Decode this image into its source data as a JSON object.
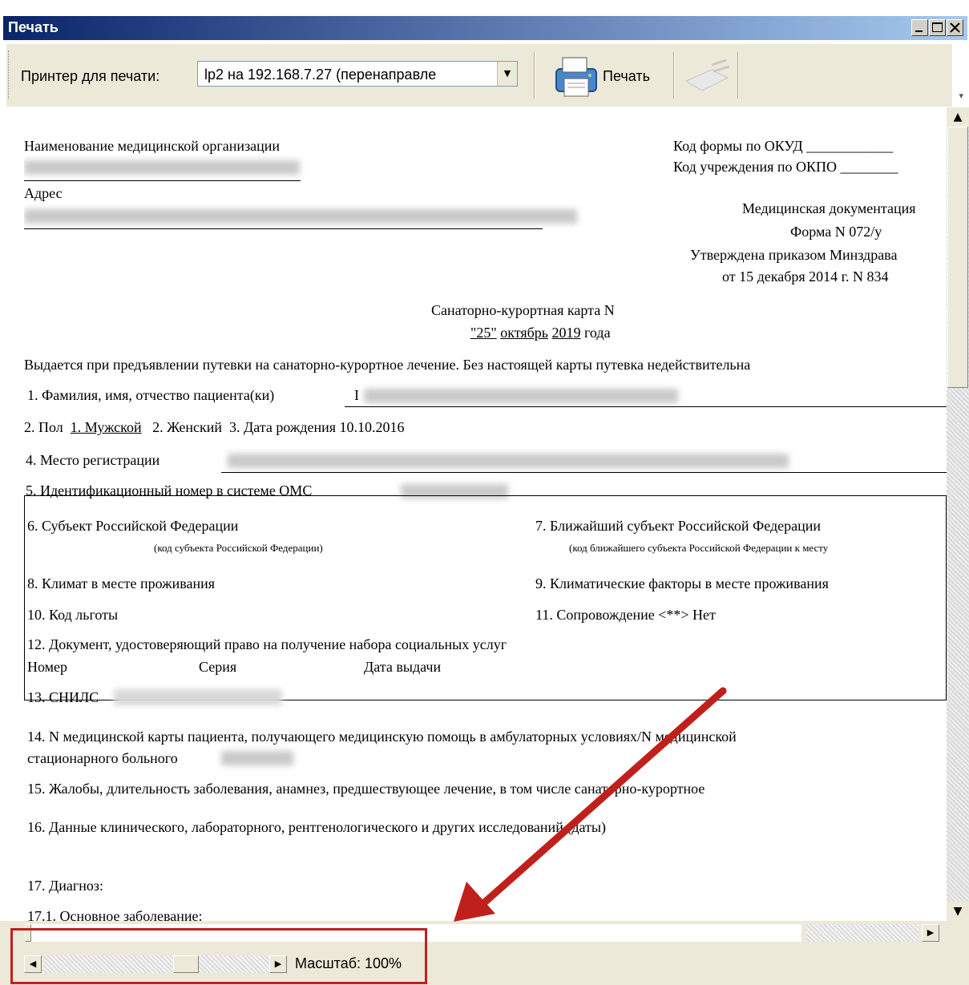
{
  "window": {
    "title": "Печать"
  },
  "toolbar": {
    "printer_label": "Принтер для печати:",
    "printer_value": "lp2 на 192.168.7.27 (перенаправле",
    "print_label": "Печать"
  },
  "doc": {
    "org_label": "Наименование медицинской организации",
    "address_label": "Адрес",
    "okud": "Код формы по ОКУД ____________",
    "okpo": "Код учреждения по ОКПО ________",
    "med_doc": "Медицинская документация",
    "form": "Форма N 072/у",
    "approved": "Утверждена приказом Минздрава",
    "approved_date": "от 15 декабря 2014 г. N 834",
    "card_title": "Санаторно-курортная карта N",
    "date_day": "\"25\"",
    "date_month": "октябрь",
    "date_year": "2019",
    "date_suffix": "года",
    "issued_note": "Выдается при предъявлении путевки на санаторно-курортное лечение. Без настоящей карты путевка недействительна",
    "f1": "1. Фамилия, имя, отчество пациента(ки)",
    "f1_initial": "I",
    "f2_prefix": "2. Пол",
    "f2_male": "1. Мужской",
    "f2_female": "2. Женский",
    "f3": "3. Дата рождения 10.10.2016",
    "f4": "4. Место регистрации",
    "f5": "5. Идентификационный номер в системе ОМС",
    "f6": "6. Субъект Российской Федерации",
    "f6_note": "(код субъекта Российской Федерации)",
    "f7": "7. Ближайший субъект Российской Федерации",
    "f7_note": "(код ближайшего субъекта Российской Федерации к месту",
    "f8": "8. Климат в месте проживания",
    "f9": "9. Климатические факторы в месте проживания",
    "f10": "10. Код льготы",
    "f11": "11. Сопровождение <**>  Нет",
    "f12": "12. Документ, удостоверяющий право на получение набора социальных услуг",
    "f12_number": "Номер",
    "f12_series": "Серия",
    "f12_date": "Дата выдачи",
    "f13": "13. СНИЛС",
    "f14_line1": "14. N  медицинской  карты  пациента,  получающего  медицинскую  помощь  в  амбулаторных  условиях/N  медицинской",
    "f14_line2": "стационарного больного",
    "f15": "15. Жалобы, длительность заболевания, анамнез, предшествующее лечение, в том числе санаторно-курортное",
    "f16": "16. Данные клинического, лабораторного, рентгенологического и других исследований (даты)",
    "f17": "17. Диагноз:",
    "f17_1": "17.1. Основное заболевание:"
  },
  "statusbar": {
    "zoom": "Масштаб: 100%"
  },
  "colors": {
    "title_gradient_start": "#0a246a",
    "title_gradient_end": "#a6caf0",
    "highlight_red": "#c0201b"
  }
}
